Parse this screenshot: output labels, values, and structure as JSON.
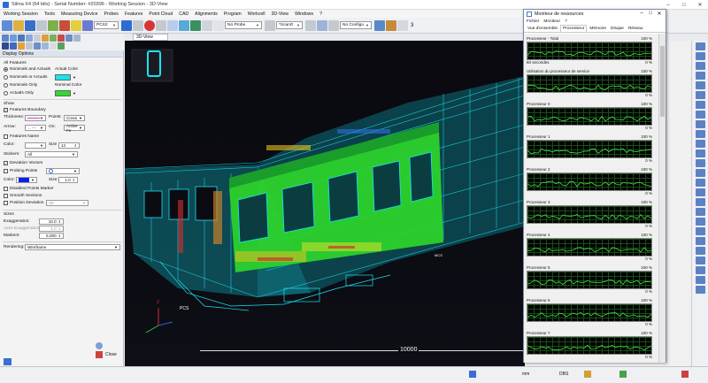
{
  "window": {
    "title": "Silma X4 (64 bits) - Serial Number: #20396 - Working Session - 3D-View"
  },
  "menu": [
    "Working Session",
    "Tools",
    "Measuring Device",
    "Probes",
    "Features",
    "Point Cloud",
    "CAD",
    "Alignments",
    "Program",
    "Workcell",
    "3D-View",
    "Windows",
    "?"
  ],
  "toolbar": {
    "frame_combo": "PCS2",
    "probe_combo": "No Probe",
    "scan_combo": "*ScanG",
    "config_combo": "No Configu",
    "count": "3"
  },
  "view_tab": "3D-View",
  "panel": {
    "title": "Display Options",
    "all_features": "All Features",
    "opt_nominals_actuals": "Nominals and Actuals",
    "opt_nominals_or_actuals": "Nominals or Actuals",
    "opt_nominals_only": "Nominals Only",
    "opt_actuals_only": "Actuals Only",
    "actual_color_label": "Actual Color",
    "nominal_color_label": "Nominal Color",
    "show_label": "Show",
    "features_boundary": "Features Boundary",
    "thickness_label": "Thickness:",
    "points_label": "Points:",
    "points_value": "Cross",
    "arrow_label": "Arrow:",
    "on_label": "On:",
    "on_value": "Active Fe",
    "features_name": "Features Name",
    "color_label": "Color:",
    "size_label": "Size",
    "size_value": "12",
    "stickers_label": "Stickers:",
    "stickers_value": "All",
    "deviation_vectors": "Deviation Vectors",
    "probing_points": "Probing Points",
    "color2_label": "Color:",
    "size2_label": "Size:",
    "size2_value": "1.0",
    "disabled_points_marker": "Disabled Points Marker",
    "smooth_sections": "Smooth Sections",
    "position_deviation": "Position Deviation",
    "position_deviation_value": "3D",
    "sizes_label": "Sizes",
    "exaggeration_label": "Exaggeration:",
    "exaggeration_value": "10.0",
    "axes_exaggeration_label": "Axes Exaggeration:",
    "axes_exaggeration_value": "1.0",
    "markers_label": "Markers:",
    "markers_value": "5.000",
    "rendering_label": "Rendering:",
    "rendering_value": "Wireframe",
    "close_label": "Close",
    "colors": {
      "actual": "#19e3f0",
      "nominal": "#2ddc2d",
      "color1": "#ffffff",
      "color2": "#0b22e6"
    }
  },
  "viewport": {
    "scale_label": "10000",
    "axis_z": "Z",
    "pcs_label": "PCS",
    "cloud_label": "MCS"
  },
  "resmon": {
    "title": "Moniteur de ressources",
    "menu": [
      "Fichier",
      "Moniteur",
      "?"
    ],
    "tabs": [
      "Vue d'ensemble",
      "Processeur",
      "Mémoire",
      "Disque",
      "Réseau"
    ],
    "active_tab": "Processeur",
    "graphs": [
      {
        "label": "Processeur - Total",
        "max": "100 %",
        "foot_left": "60 secondes",
        "foot_right": "0 %"
      },
      {
        "label": "Utilisation du processeur de service",
        "max": "100 %",
        "foot_left": "",
        "foot_right": "0 %"
      },
      {
        "label": "Processeur 0",
        "max": "100 %",
        "foot_left": "",
        "foot_right": "0 %"
      },
      {
        "label": "Processeur 1",
        "max": "100 %",
        "foot_left": "",
        "foot_right": "0 %"
      },
      {
        "label": "Processeur 2",
        "max": "100 %",
        "foot_left": "",
        "foot_right": "0 %"
      },
      {
        "label": "Processeur 3",
        "max": "100 %",
        "foot_left": "",
        "foot_right": "0 %"
      },
      {
        "label": "Processeur 4",
        "max": "100 %",
        "foot_left": "",
        "foot_right": "0 %"
      },
      {
        "label": "Processeur 5",
        "max": "100 %",
        "foot_left": "",
        "foot_right": "0 %"
      },
      {
        "label": "Processeur 6",
        "max": "100 %",
        "foot_left": "",
        "foot_right": "0 %"
      },
      {
        "label": "Processeur 7",
        "max": "100 %",
        "foot_left": "",
        "foot_right": "0 %"
      }
    ]
  },
  "status": {
    "unit": "mm",
    "mode": "DBS"
  }
}
